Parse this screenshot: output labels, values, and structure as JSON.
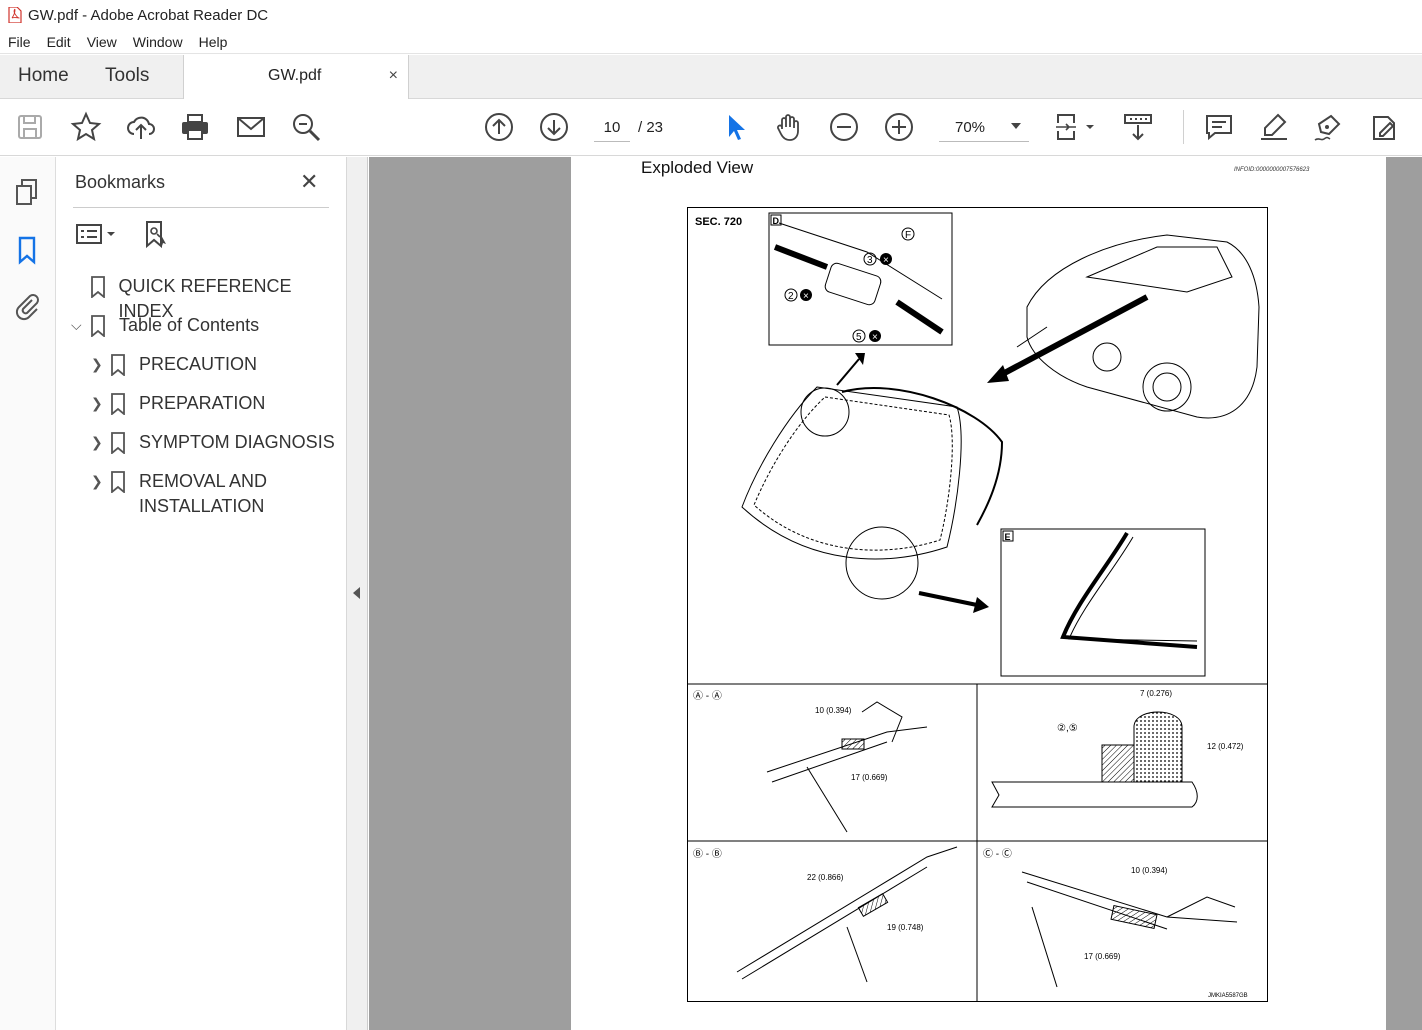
{
  "window": {
    "title": "GW.pdf - Adobe Acrobat Reader DC"
  },
  "menu": [
    "File",
    "Edit",
    "View",
    "Window",
    "Help"
  ],
  "tabs": {
    "home": "Home",
    "tools": "Tools",
    "document": "GW.pdf",
    "close_glyph": "×"
  },
  "toolbar": {
    "current_page": "10",
    "total_pages": "/ 23",
    "zoom": "70%"
  },
  "bookmarks": {
    "title": "Bookmarks",
    "items": [
      {
        "label": "QUICK REFERENCE INDEX",
        "level": 0,
        "expandable": false
      },
      {
        "label": "Table of Contents",
        "level": 0,
        "expandable": true,
        "expanded": true
      },
      {
        "label": "PRECAUTION",
        "level": 1,
        "expandable": true
      },
      {
        "label": "PREPARATION",
        "level": 1,
        "expandable": true
      },
      {
        "label": "SYMPTOM DIAGNOSIS",
        "level": 1,
        "expandable": true
      },
      {
        "label": "REMOVAL AND",
        "label2": "INSTALLATION",
        "level": 1,
        "expandable": true
      }
    ]
  },
  "page": {
    "heading": "Exploded View",
    "info_id": "INFOID:0000000007576623",
    "figure": {
      "section": "SEC. 720",
      "detail_d": "D",
      "detail_e": "E",
      "sec_aa": "Ⓐ - Ⓐ",
      "sec_bb": "Ⓑ - Ⓑ",
      "sec_cc": "Ⓒ - Ⓒ",
      "dim_aa_1": "10 (0.394)",
      "dim_aa_2": "17 (0.669)",
      "dim_bead_w": "7 (0.276)",
      "dim_bead_h": "12 (0.472)",
      "bead_parts": "②,⑤",
      "dim_bb_1": "22 (0.866)",
      "dim_bb_2": "19 (0.748)",
      "dim_cc_1": "10 (0.394)",
      "dim_cc_2": "17 (0.669)",
      "figure_id": "JMKIA5587GB"
    }
  }
}
